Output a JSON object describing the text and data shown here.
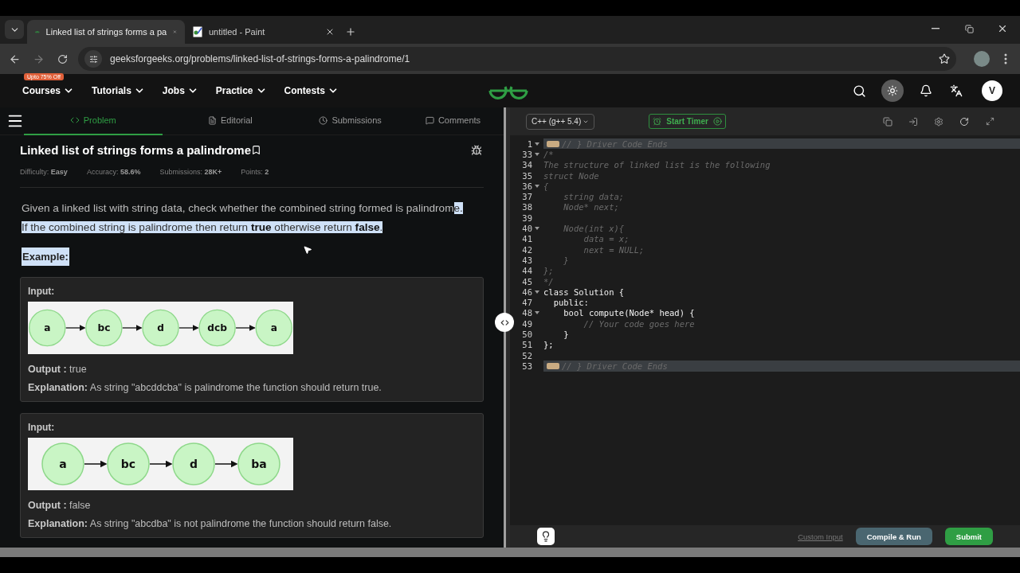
{
  "browser": {
    "tabs": [
      {
        "title": "Linked list of strings forms a pa",
        "kind": "site",
        "selected": true
      },
      {
        "title": "untitled - Paint",
        "kind": "paint",
        "selected": false
      }
    ],
    "address": "geeksforgeeks.org/problems/linked-list-of-strings-forms-a-palindrome/1"
  },
  "site_nav": {
    "promo": "Upto 75% Off",
    "items": [
      "Courses",
      "Tutorials",
      "Jobs",
      "Practice",
      "Contests"
    ],
    "avatar": "V"
  },
  "problem_tabs": [
    {
      "label": "Problem",
      "kind": "code",
      "selected": true
    },
    {
      "label": "Editorial",
      "kind": "doc",
      "selected": false
    },
    {
      "label": "Submissions",
      "kind": "clock",
      "selected": false
    },
    {
      "label": "Comments",
      "kind": "chat",
      "selected": false
    }
  ],
  "problem": {
    "title": "Linked list of strings forms a palindrome",
    "meta": [
      "Difficulty: **Easy**",
      "Accuracy: **58.6%**",
      "Submissions: **28K+**",
      "Points: **2**"
    ],
    "description": {
      "plain": "Given a linked list with string data, check whether the combined string formed is palindrom",
      "highlighted": "e. If the combined string is palindrome then return **true** otherwise return **false**."
    },
    "example_heading": {
      "text": "Example:",
      "highlighted": true
    },
    "examples": [
      {
        "input_label": "Input:",
        "nodes": [
          "a",
          "bc",
          "d",
          "dcb",
          "a"
        ],
        "output": "**Output :** true",
        "explanation": "**Explanation:** As string \"abcddcba\" is palindrome the function should return true."
      },
      {
        "input_label": "Input:",
        "nodes": [
          "a",
          "bc",
          "d",
          "ba"
        ],
        "output": "**Output :** false",
        "explanation": "**Explanation:** As string \"abcdba\" is not palindrome the function should return false."
      }
    ]
  },
  "editor": {
    "language": "C++ (g++ 5.4)",
    "timer": "Start Timer",
    "lines": [
      {
        "number": "1",
        "text": "// } Driver Code Ends",
        "kind": "folded",
        "foldable": true
      },
      {
        "number": "33",
        "text": "/*",
        "kind": "comment",
        "foldable": true
      },
      {
        "number": "34",
        "text": "The structure of linked list is the following",
        "kind": "comment",
        "foldable": false
      },
      {
        "number": "35",
        "text": "struct Node",
        "kind": "comment",
        "foldable": false
      },
      {
        "number": "36",
        "text": "{",
        "kind": "comment",
        "foldable": true
      },
      {
        "number": "37",
        "text": "    string data;",
        "kind": "comment",
        "foldable": false
      },
      {
        "number": "38",
        "text": "    Node* next;",
        "kind": "comment",
        "foldable": false
      },
      {
        "number": "39",
        "kind": "comment",
        "foldable": false
      },
      {
        "number": "40",
        "text": "    Node(int x){",
        "kind": "comment",
        "foldable": true
      },
      {
        "number": "41",
        "text": "        data = x;",
        "kind": "comment",
        "foldable": false
      },
      {
        "number": "42",
        "text": "        next = NULL;",
        "kind": "comment",
        "foldable": false
      },
      {
        "number": "43",
        "text": "    }",
        "kind": "comment",
        "foldable": false
      },
      {
        "number": "44",
        "text": "};",
        "kind": "comment",
        "foldable": false
      },
      {
        "number": "45",
        "text": "*/",
        "kind": "comment",
        "foldable": false
      },
      {
        "number": "46",
        "text": "class Solution {",
        "kind": "code",
        "foldable": true
      },
      {
        "number": "47",
        "text": "  public:",
        "kind": "code",
        "foldable": false
      },
      {
        "number": "48",
        "text": "    bool compute(Node* head) {",
        "kind": "code",
        "foldable": true
      },
      {
        "number": "49",
        "text": "        // Your code goes here",
        "kind": "comment",
        "foldable": false
      },
      {
        "number": "50",
        "text": "    }",
        "kind": "code",
        "foldable": false
      },
      {
        "number": "51",
        "text": "};",
        "kind": "code",
        "foldable": false
      },
      {
        "number": "52",
        "kind": "code",
        "foldable": false
      },
      {
        "number": "53",
        "text": "// } Driver Code Ends",
        "kind": "folded",
        "foldable": false
      }
    ],
    "custom_input": "Custom Input",
    "run": "Compile & Run",
    "submit": "Submit"
  }
}
